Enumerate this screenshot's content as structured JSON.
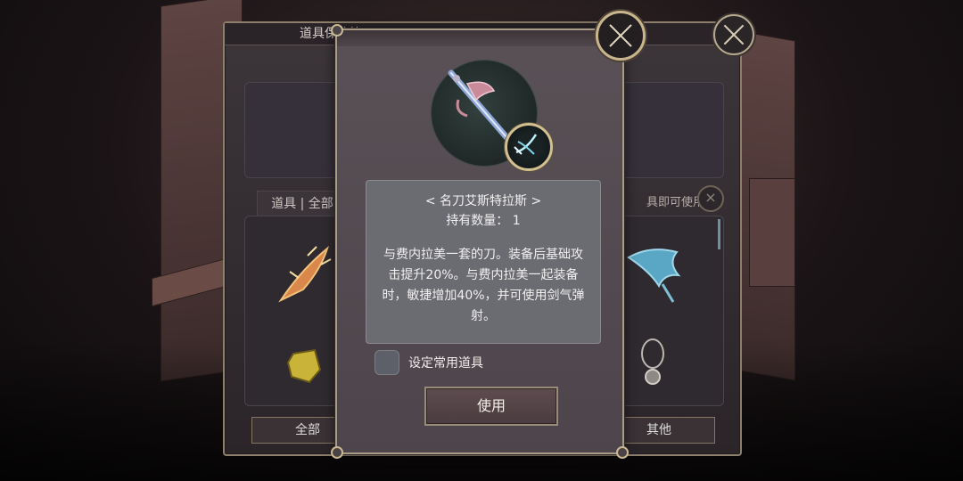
{
  "background_dialog": {
    "title": "道具保管箱",
    "tab_label": "道具 | 全部",
    "hint": "具即可使用",
    "filter_all": "全部",
    "filter_other": "其他"
  },
  "item_popup": {
    "name": "< 名刀艾斯特拉斯 >",
    "quantity_text": "持有数量： 1",
    "description": "与费内拉美一套的刀。装备后基础攻击提升20%。与费内拉美一起装备时，敏捷增加40%，并可使用剑气弹射。",
    "favorite_label": "设定常用道具",
    "favorite_checked": false,
    "use_button": "使用"
  },
  "icons": {
    "close": "close-x-icon",
    "skill_badge": "sword-slash-icon",
    "item": "sword-icon"
  },
  "colors": {
    "frame_gold": "#a99c86",
    "panel": "#4d454b",
    "desc_box": "#6b6c72"
  }
}
